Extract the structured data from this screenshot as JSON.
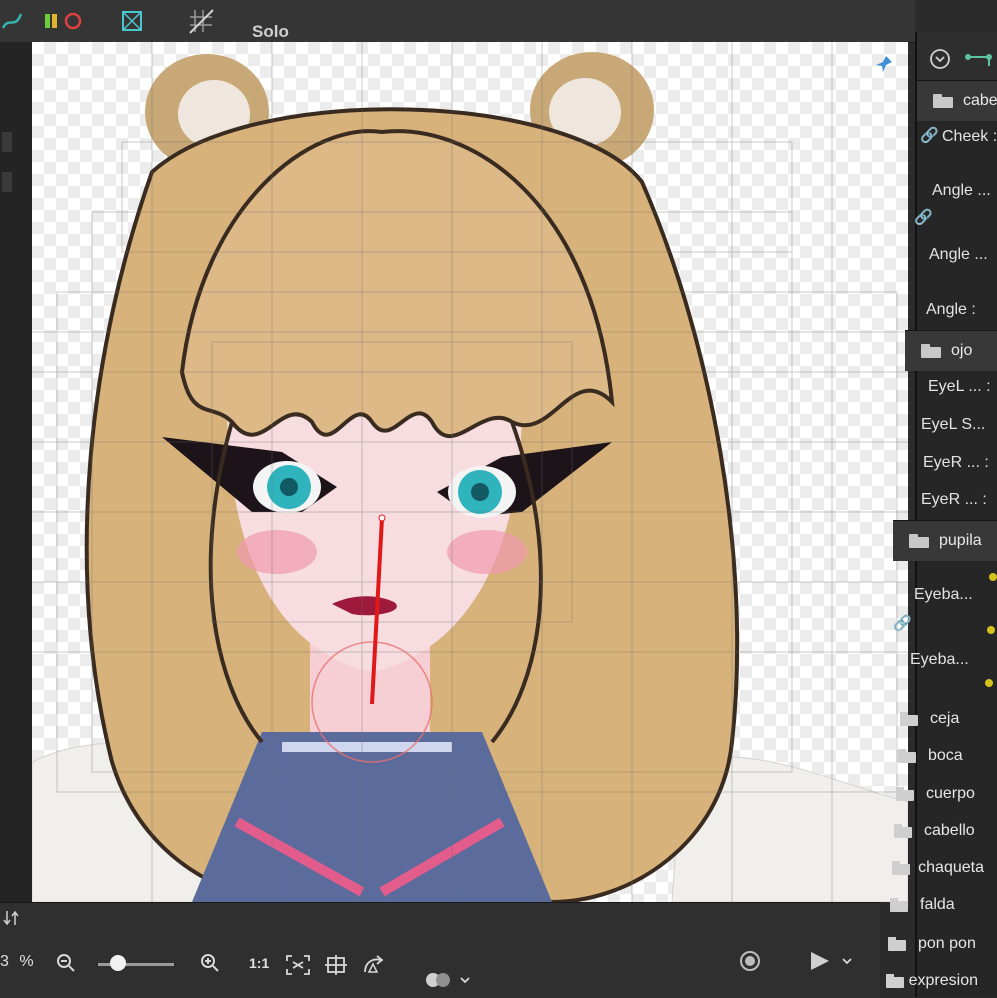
{
  "toolbar": {
    "solo_label": "Solo"
  },
  "canvas": {
    "zoom_suffix": "3",
    "zoom_unit": "%",
    "ratio_label": "1:1"
  },
  "right_panel": {
    "groups": [
      {
        "label": "cabe"
      },
      {
        "label": "ojo"
      },
      {
        "label": "pupila"
      }
    ],
    "params_cabe": [
      "Cheek :",
      "Angle ...",
      "Angle ...",
      "Angle :"
    ],
    "params_ojo": [
      "EyeL ... :",
      "EyeL S...",
      "EyeR ... :",
      "EyeR ... :"
    ],
    "params_pupila": [
      "Eyeba...",
      "Eyeba..."
    ],
    "folders": [
      "ceja",
      "boca",
      "cuerpo",
      "cabello",
      "chaqueta",
      "falda",
      "pon pon",
      "expresion"
    ]
  },
  "colors": {
    "accent_red": "#e01818",
    "param_dot": "#d6c21c",
    "hair": "#d7b27a"
  }
}
